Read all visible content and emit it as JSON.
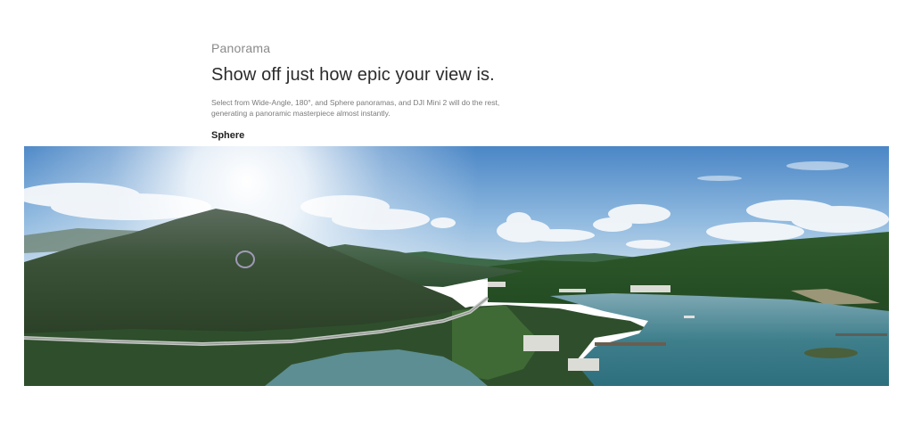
{
  "section": {
    "eyebrow": "Panorama",
    "headline": "Show off just how epic your view is.",
    "description": "Select from Wide-Angle, 180°, and Sphere panoramas, and DJI Mini 2 will do the rest, generating a panoramic masterpiece almost instantly.",
    "mode_label": "Sphere"
  },
  "colors": {
    "eyebrow": "#8a8a8a",
    "headline": "#2b2b2b",
    "description": "#7b7b7b",
    "sky_top": "#3f7fc4",
    "mountain": "#2f4a30",
    "water": "#3f7f8c"
  }
}
